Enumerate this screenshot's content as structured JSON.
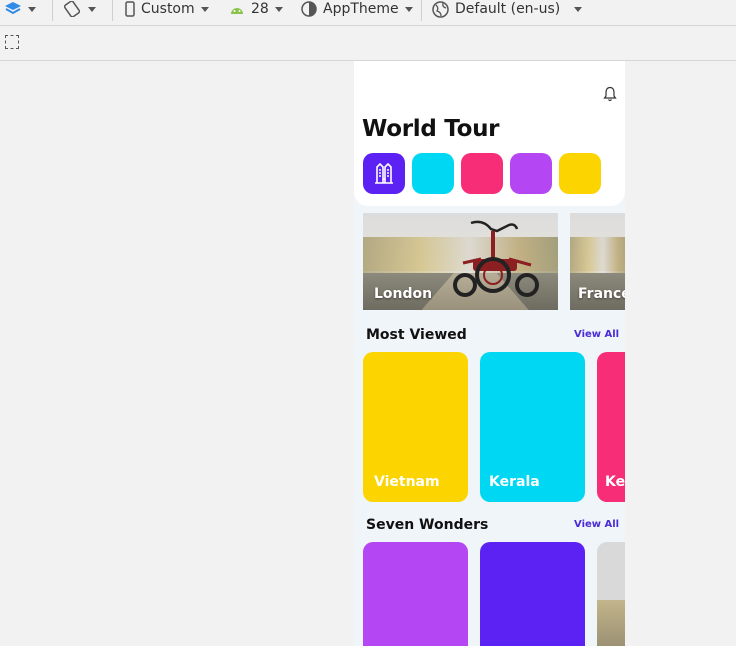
{
  "toolbar": {
    "device": "Custom",
    "api_level": "28",
    "theme": "AppTheme",
    "locale": "Default (en-us)"
  },
  "app": {
    "title": "World Tour",
    "categories": [
      {
        "color": "#5b22f3",
        "icon": "building-icon"
      },
      {
        "color": "#00d7f3"
      },
      {
        "color": "#f72d78"
      },
      {
        "color": "#b546f3"
      },
      {
        "color": "#fcd400"
      }
    ],
    "places": [
      {
        "label": "London"
      },
      {
        "label": "France"
      }
    ],
    "most_viewed": {
      "title": "Most Viewed",
      "view_all": "View All",
      "cards": [
        {
          "label": "Vietnam",
          "color": "#fcd400"
        },
        {
          "label": "Kerala",
          "color": "#00d7f3"
        },
        {
          "label": "Kerala",
          "color": "#f72d78"
        }
      ]
    },
    "seven_wonders": {
      "title": "Seven Wonders",
      "view_all": "View All",
      "cards": [
        {
          "color": "#b546f3"
        },
        {
          "color": "#5b22f3"
        },
        {
          "color": "#d9d9d9"
        }
      ]
    }
  }
}
